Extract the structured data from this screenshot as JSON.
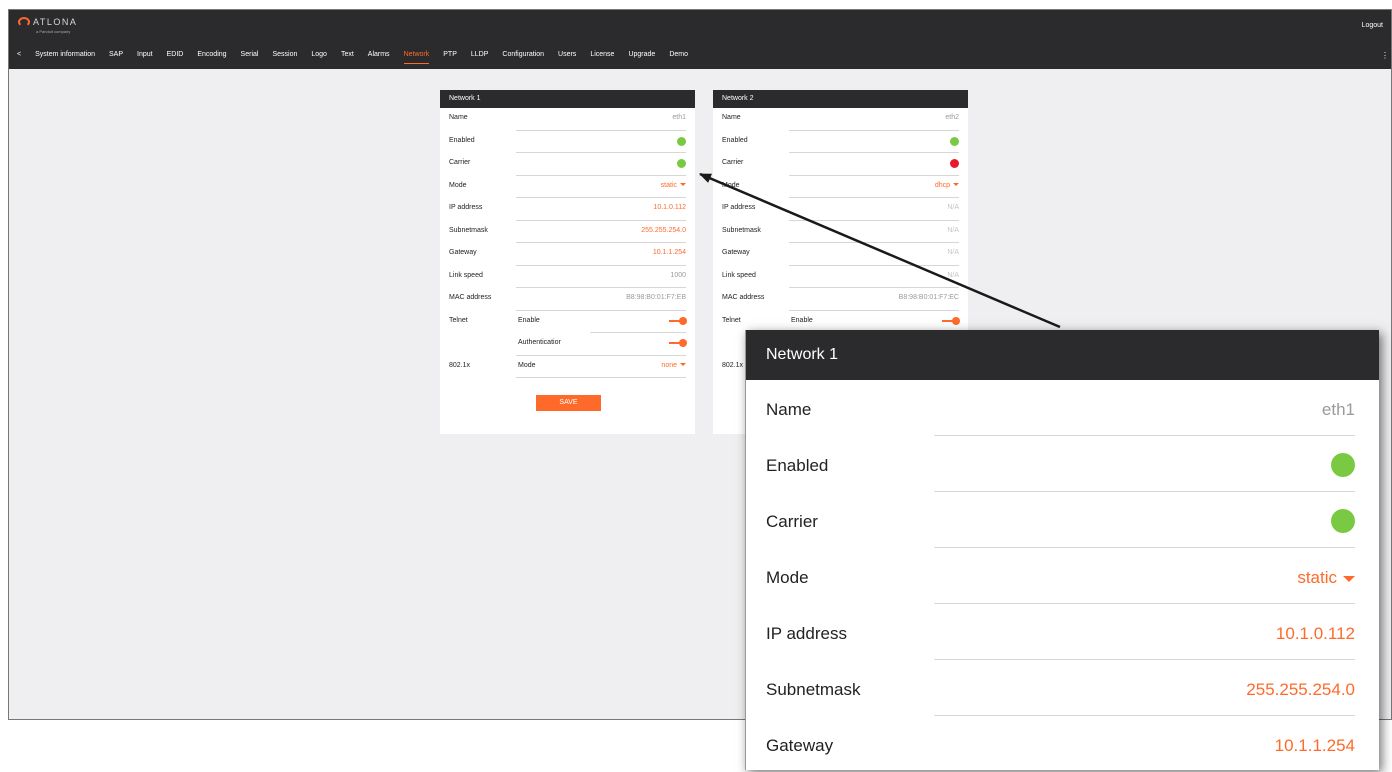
{
  "header": {
    "brand": "ATLONA",
    "brand_sub": "a Panduit company",
    "logout_label": "Logout",
    "nav_back": "<",
    "nav_items": [
      "System information",
      "SAP",
      "Input",
      "EDID",
      "Encoding",
      "Serial",
      "Session",
      "Logo",
      "Text",
      "Alarms",
      "Network",
      "PTP",
      "LLDP",
      "Configuration",
      "Users",
      "License",
      "Upgrade",
      "Demo"
    ],
    "active_tab": "Network",
    "more_icon": "⋮"
  },
  "colors": {
    "accent": "#ff6a2a",
    "status_on": "#7ac943",
    "status_off": "#e8192c",
    "header_bg": "#2b2b2d"
  },
  "network1": {
    "title": "Network 1",
    "rows": [
      {
        "label": "Name",
        "value": "eth1"
      },
      {
        "label": "Enabled",
        "status": "green"
      },
      {
        "label": "Carrier",
        "status": "green"
      },
      {
        "label": "Mode",
        "value": "static"
      },
      {
        "label": "IP address",
        "value": "10.1.0.112"
      },
      {
        "label": "Subnetmask",
        "value": "255.255.254.0"
      },
      {
        "label": "Gateway",
        "value": "10.1.1.254"
      },
      {
        "label": "Link speed",
        "value": "1000"
      },
      {
        "label": "MAC address",
        "value": "B8:98:B0:01:F7:EB"
      }
    ],
    "telnet": {
      "label": "Telnet",
      "enable_label": "Enable",
      "enable_on": true,
      "auth_label": "Authenticatior",
      "auth_on": true
    },
    "dot1x": {
      "label": "802.1x",
      "mode_label": "Mode",
      "mode_value": "none"
    },
    "save_label": "SAVE"
  },
  "network2": {
    "title": "Network 2",
    "rows": [
      {
        "label": "Name",
        "value": "eth2"
      },
      {
        "label": "Enabled",
        "status": "green"
      },
      {
        "label": "Carrier",
        "status": "red"
      },
      {
        "label": "Mode",
        "value": "dhcp"
      },
      {
        "label": "IP address",
        "value": "N/A"
      },
      {
        "label": "Subnetmask",
        "value": "N/A"
      },
      {
        "label": "Gateway",
        "value": "N/A"
      },
      {
        "label": "Link speed",
        "value": "N/A"
      },
      {
        "label": "MAC address",
        "value": "B8:98:B0:01:F7:EC"
      }
    ],
    "telnet": {
      "label": "Telnet",
      "enable_label": "Enable",
      "enable_on": true
    },
    "dot1x": {
      "label": "802.1x"
    }
  },
  "zoom": {
    "title": "Network 1",
    "rows": [
      {
        "label": "Name",
        "value": "eth1"
      },
      {
        "label": "Enabled",
        "status": "green"
      },
      {
        "label": "Carrier",
        "status": "green"
      },
      {
        "label": "Mode",
        "value": "static"
      },
      {
        "label": "IP address",
        "value": "10.1.0.112"
      },
      {
        "label": "Subnetmask",
        "value": "255.255.254.0"
      },
      {
        "label": "Gateway",
        "value": "10.1.1.254"
      }
    ]
  }
}
